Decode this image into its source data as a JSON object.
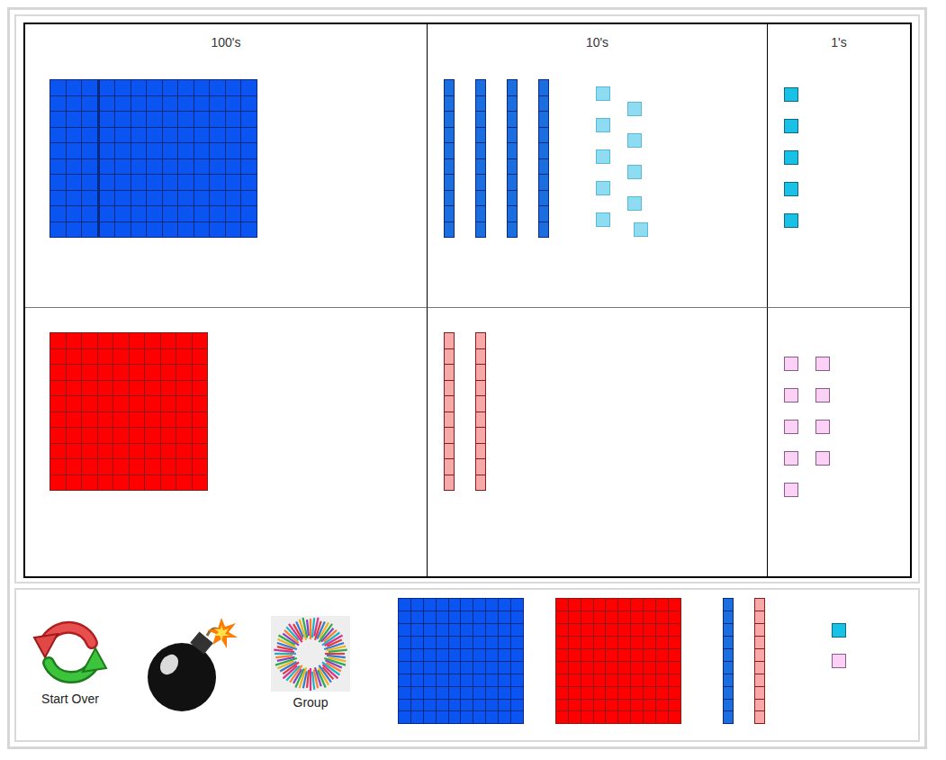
{
  "board": {
    "columns": [
      "100's",
      "10's",
      "1's"
    ],
    "rows": [
      {
        "sign": "positive",
        "flat_color": "#0a55f2",
        "rod_color": "#1a6ee0",
        "unit_color": "#19c1e6",
        "line_color": "#0a2a80",
        "unit_border": "#0a6b85",
        "hundreds": {
          "flats": 1,
          "extra_rods": 3
        },
        "tens": {
          "rods": 4,
          "faded_units": 10,
          "faded_color": "#8ddcf2",
          "faded_border": "#5ab8d8"
        },
        "ones": {
          "units": 5
        }
      },
      {
        "sign": "negative",
        "flat_color": "#ff0000",
        "rod_color": "#f7a8a8",
        "unit_color": "#fbd2f6",
        "line_color": "#8c1a1a",
        "unit_border": "#8a5a88",
        "hundreds": {
          "flats": 1,
          "extra_rods": 0
        },
        "tens": {
          "rods": 2,
          "faded_units": 0,
          "faded_color": "#8ddcf2",
          "faded_border": "#5ab8d8"
        },
        "ones": {
          "units": 9
        }
      }
    ]
  },
  "toolbar": {
    "tools": [
      {
        "kind": "reset",
        "label": "Start Over"
      },
      {
        "kind": "bomb"
      },
      {
        "kind": "group",
        "label": "Group"
      }
    ],
    "palette": [
      {
        "kind": "flat",
        "sign": "positive",
        "fill": "#0a55f2",
        "line": "#0a2a80"
      },
      {
        "kind": "flat",
        "sign": "negative",
        "fill": "#ff0000",
        "line": "#8c1a1a"
      },
      {
        "kind": "rod",
        "sign": "positive",
        "fill": "#1a6ee0",
        "line": "#0a2a80"
      },
      {
        "kind": "rod",
        "sign": "negative",
        "fill": "#f7a8a8",
        "line": "#8c1a1a"
      },
      {
        "kind": "unit",
        "sign": "positive",
        "fill": "#19c1e6",
        "line": "#0a6b85"
      },
      {
        "kind": "unit",
        "sign": "negative",
        "fill": "#fbd2f6",
        "line": "#8a5a88"
      }
    ]
  }
}
